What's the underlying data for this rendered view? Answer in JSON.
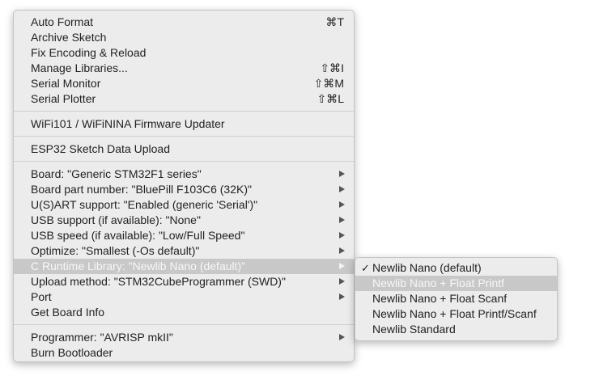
{
  "menu": {
    "groups": [
      [
        {
          "label": "Auto Format",
          "shortcut": "⌘T"
        },
        {
          "label": "Archive Sketch"
        },
        {
          "label": "Fix Encoding & Reload"
        },
        {
          "label": "Manage Libraries...",
          "shortcut": "⇧⌘I"
        },
        {
          "label": "Serial Monitor",
          "shortcut": "⇧⌘M"
        },
        {
          "label": "Serial Plotter",
          "shortcut": "⇧⌘L"
        }
      ],
      [
        {
          "label": "WiFi101 / WiFiNINA Firmware Updater"
        }
      ],
      [
        {
          "label": "ESP32 Sketch Data Upload"
        }
      ],
      [
        {
          "label": "Board: \"Generic STM32F1 series\"",
          "submenu": true
        },
        {
          "label": "Board part number: \"BluePill F103C6 (32K)\"",
          "submenu": true
        },
        {
          "label": "U(S)ART support: \"Enabled (generic 'Serial')\"",
          "submenu": true
        },
        {
          "label": "USB support (if available): \"None\"",
          "submenu": true
        },
        {
          "label": "USB speed (if available): \"Low/Full Speed\"",
          "submenu": true
        },
        {
          "label": "Optimize: \"Smallest (-Os default)\"",
          "submenu": true
        },
        {
          "label": "C Runtime Library: \"Newlib Nano (default)\"",
          "submenu": true,
          "highlighted": true
        },
        {
          "label": "Upload method: \"STM32CubeProgrammer (SWD)\"",
          "submenu": true
        },
        {
          "label": "Port",
          "submenu": true
        },
        {
          "label": "Get Board Info"
        }
      ],
      [
        {
          "label": "Programmer: \"AVRISP mkII\"",
          "submenu": true
        },
        {
          "label": "Burn Bootloader"
        }
      ]
    ]
  },
  "submenu": {
    "check_glyph": "✓",
    "items": [
      {
        "label": "Newlib Nano (default)",
        "checked": true
      },
      {
        "label": "Newlib Nano + Float Printf",
        "highlighted": true
      },
      {
        "label": "Newlib Nano + Float Scanf"
      },
      {
        "label": "Newlib Nano + Float Printf/Scanf"
      },
      {
        "label": "Newlib Standard"
      }
    ]
  },
  "colors": {
    "menu_bg": "#ececec",
    "highlight_bg": "#c8c8c8",
    "highlight_text": "#f7f7f7"
  }
}
